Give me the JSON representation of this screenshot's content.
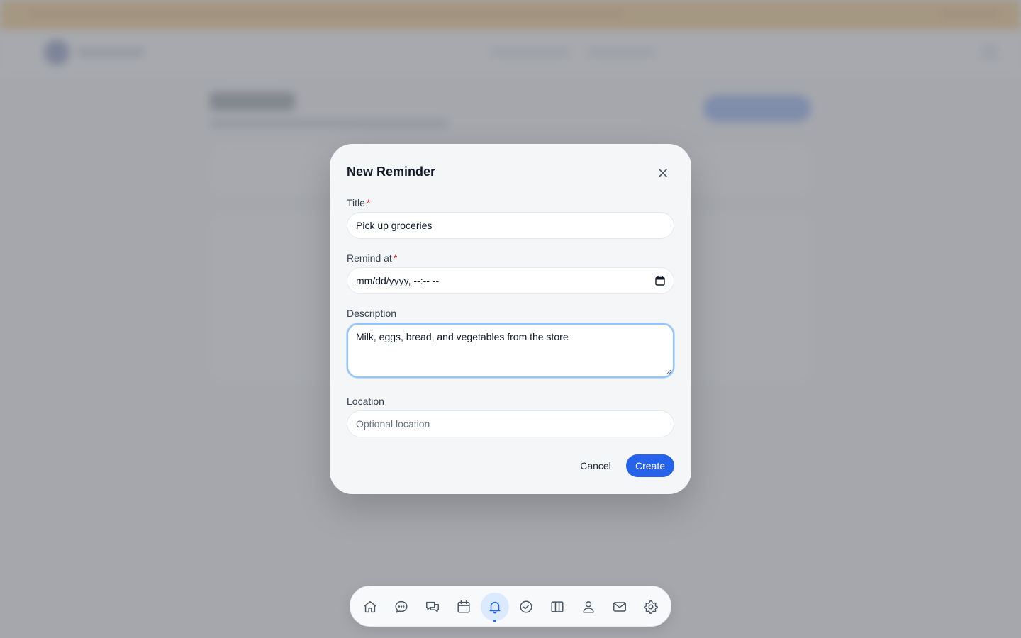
{
  "modal": {
    "title": "New Reminder",
    "fields": {
      "title": {
        "label": "Title",
        "required_mark": "*",
        "value": "Pick up groceries"
      },
      "remind_at": {
        "label": "Remind at",
        "required_mark": "*",
        "value": "mm/dd/yyyy, --:-- --"
      },
      "description": {
        "label": "Description",
        "value": "Milk, eggs, bread, and vegetables from the store"
      },
      "location": {
        "label": "Location",
        "value": "",
        "placeholder": "Optional location"
      }
    },
    "actions": {
      "cancel_label": "Cancel",
      "create_label": "Create"
    }
  },
  "dock": {
    "items": [
      {
        "name": "home",
        "icon": "home-icon"
      },
      {
        "name": "chat",
        "icon": "chat-bubble-icon"
      },
      {
        "name": "messages",
        "icon": "messages-icon"
      },
      {
        "name": "calendar",
        "icon": "calendar-icon"
      },
      {
        "name": "reminders",
        "icon": "bell-icon",
        "active": true
      },
      {
        "name": "tasks",
        "icon": "check-circle-icon"
      },
      {
        "name": "board",
        "icon": "columns-icon"
      },
      {
        "name": "contacts",
        "icon": "user-icon"
      },
      {
        "name": "mail",
        "icon": "mail-icon"
      },
      {
        "name": "settings",
        "icon": "gear-icon"
      }
    ]
  },
  "colors": {
    "accent": "#2563eb",
    "required": "#dc2626",
    "banner": "#f59e0b",
    "focus_ring": "#93c5fd"
  }
}
